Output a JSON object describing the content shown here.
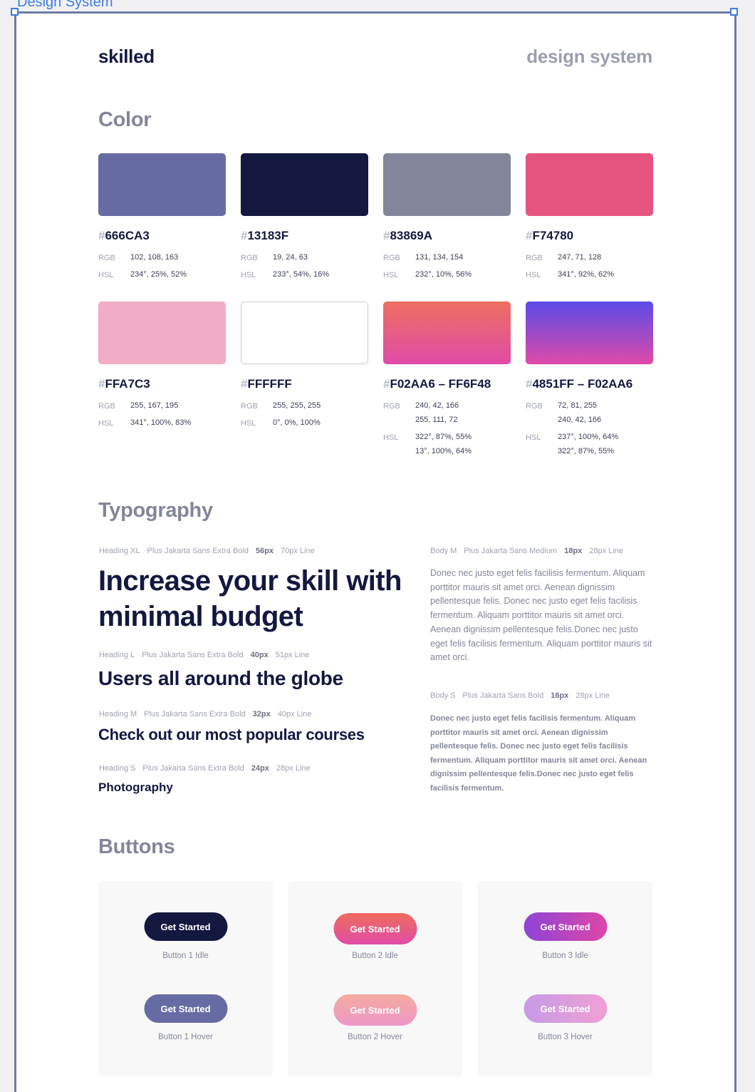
{
  "frame": {
    "label": "Design System"
  },
  "header": {
    "brand": "skilled",
    "subtitle": "design system"
  },
  "sections": {
    "color": "Color",
    "typography": "Typography",
    "buttons": "Buttons"
  },
  "colors": [
    {
      "hex": "666CA3",
      "swatch": "#666CA3",
      "rgb": [
        "102, 108, 163"
      ],
      "hsl": [
        "234°, 25%, 52%"
      ]
    },
    {
      "hex": "13183F",
      "swatch": "#13183F",
      "rgb": [
        "19, 24, 63"
      ],
      "hsl": [
        "233°, 54%, 16%"
      ]
    },
    {
      "hex": "83869A",
      "swatch": "#83869A",
      "rgb": [
        "131, 134, 154"
      ],
      "hsl": [
        "232°, 10%, 56%"
      ]
    },
    {
      "hex": "F74780",
      "swatch": "#E5547F",
      "rgb": [
        "247, 71, 128"
      ],
      "hsl": [
        "341°, 92%, 62%"
      ]
    },
    {
      "hex": "FFA7C3",
      "swatch": "#F2ADC6",
      "rgb": [
        "255, 167, 195"
      ],
      "hsl": [
        "341°, 100%, 83%"
      ]
    },
    {
      "hex": "FFFFFF",
      "swatch": "#FFFFFF",
      "rgb": [
        "255, 255, 255"
      ],
      "hsl": [
        "0°, 0%, 100%"
      ]
    },
    {
      "hex": "F02AA6 – FF6F48",
      "gradient": [
        "#ED7060",
        "#E04BA8"
      ],
      "rgb": [
        "240, 42, 166",
        "255, 111, 72"
      ],
      "hsl": [
        "322°, 87%, 55%",
        "13°, 100%, 64%"
      ]
    },
    {
      "hex": "4851FF – F02AA6",
      "gradient": [
        "#5A4BE9",
        "#E04BA8"
      ],
      "rgb": [
        "72, 81, 255",
        "240, 42, 166"
      ],
      "hsl": [
        "237°, 100%, 64%",
        "322°, 87%, 55%"
      ]
    }
  ],
  "labels": {
    "rgb": "RGB",
    "hsl": "HSL",
    "hash": "#"
  },
  "typography": {
    "heading_xl": {
      "name": "Heading XL",
      "font": "Plus Jakarta Sans Extra Bold",
      "size": "56px",
      "line": "70px Line",
      "sample": "Increase your skill with minimal budget"
    },
    "heading_l": {
      "name": "Heading L",
      "font": "Plus Jakarta Sans Extra Bold",
      "size": "40px",
      "line": "51px Line",
      "sample": "Users all around the globe"
    },
    "heading_m": {
      "name": "Heading M",
      "font": "Plus Jakarta Sans Extra Bold",
      "size": "32px",
      "line": "40px Line",
      "sample": "Check out our most popular courses"
    },
    "heading_s": {
      "name": "Heading S",
      "font": "Plus Jakarta Sans Extra Bold",
      "size": "24px",
      "line": "28px Line",
      "sample": "Photography"
    },
    "body_m": {
      "name": "Body M",
      "font": "Plus Jakarta Sans Medium",
      "size": "18px",
      "line": "28px Line",
      "sample": "Donec nec justo eget felis facilisis fermentum. Aliquam porttitor mauris sit amet orci. Aenean dignissim pellentesque felis. Donec nec justo eget felis facilisis fermentum. Aliquam porttitor mauris sit amet orci. Aenean dignissim pellentesque felis.Donec nec justo eget felis facilisis fermentum. Aliquam porttitor mauris sit amet orci."
    },
    "body_s": {
      "name": "Body S",
      "font": "Plus Jakarta Sans Bold",
      "size": "16px",
      "line": "28px Line",
      "sample": "Donec nec justo eget felis facilisis fermentum. Aliquam porttitor mauris sit amet orci. Aenean dignissim pellentesque felis. Donec nec justo eget felis facilisis fermentum. Aliquam porttitor mauris sit amet orci. Aenean dignissim pellentesque felis.Donec nec justo eget felis facilisis fermentum."
    }
  },
  "buttons": [
    {
      "idle_label": "Get Started",
      "idle_caption": "Button 1 Idle",
      "hover_label": "Get Started",
      "hover_caption": "Button 1 Hover"
    },
    {
      "idle_label": "Get Started",
      "idle_caption": "Button 2 Idle",
      "hover_label": "Get Started",
      "hover_caption": "Button 2 Hover"
    },
    {
      "idle_label": "Get Started",
      "idle_caption": "Button 3 Idle",
      "hover_label": "Get Started",
      "hover_caption": "Button 3 Hover"
    }
  ]
}
